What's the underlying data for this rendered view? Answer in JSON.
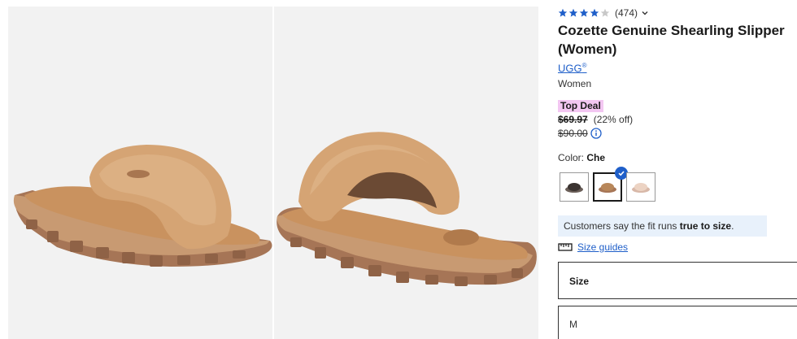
{
  "gallery": {
    "images": [
      {
        "alt": "front"
      },
      {
        "alt": "back"
      }
    ]
  },
  "product": {
    "rating": {
      "stars_filled": 4,
      "stars_total": 5,
      "count": "(474)"
    },
    "title": "Cozette Genuine Shearling Slipper (Women)",
    "brand": "UGG",
    "brand_mark": "®",
    "department": "Women",
    "deal_badge": "Top Deal",
    "price_now": "$69.97",
    "discount": "(22% off)",
    "price_was": "$90.00",
    "color_label": "Color:",
    "color_value": "Che",
    "swatches": [
      {
        "name": "Black",
        "selected": false,
        "color": "#3a3330"
      },
      {
        "name": "Chestnut",
        "selected": true,
        "color": "#b8875a"
      },
      {
        "name": "Pink",
        "selected": false,
        "color": "#ecd3c3"
      }
    ],
    "fit_text_prefix": "Customers say the fit runs ",
    "fit_text_bold": "true to size",
    "fit_text_suffix": ".",
    "size_guide": "Size guides",
    "size_label": "Size",
    "size_value": "M"
  },
  "colors": {
    "link": "#1f5fc9",
    "star": "#1f5fc9",
    "deal_bg": "#f3c7f2",
    "fit_bg": "#e8f1fb"
  }
}
